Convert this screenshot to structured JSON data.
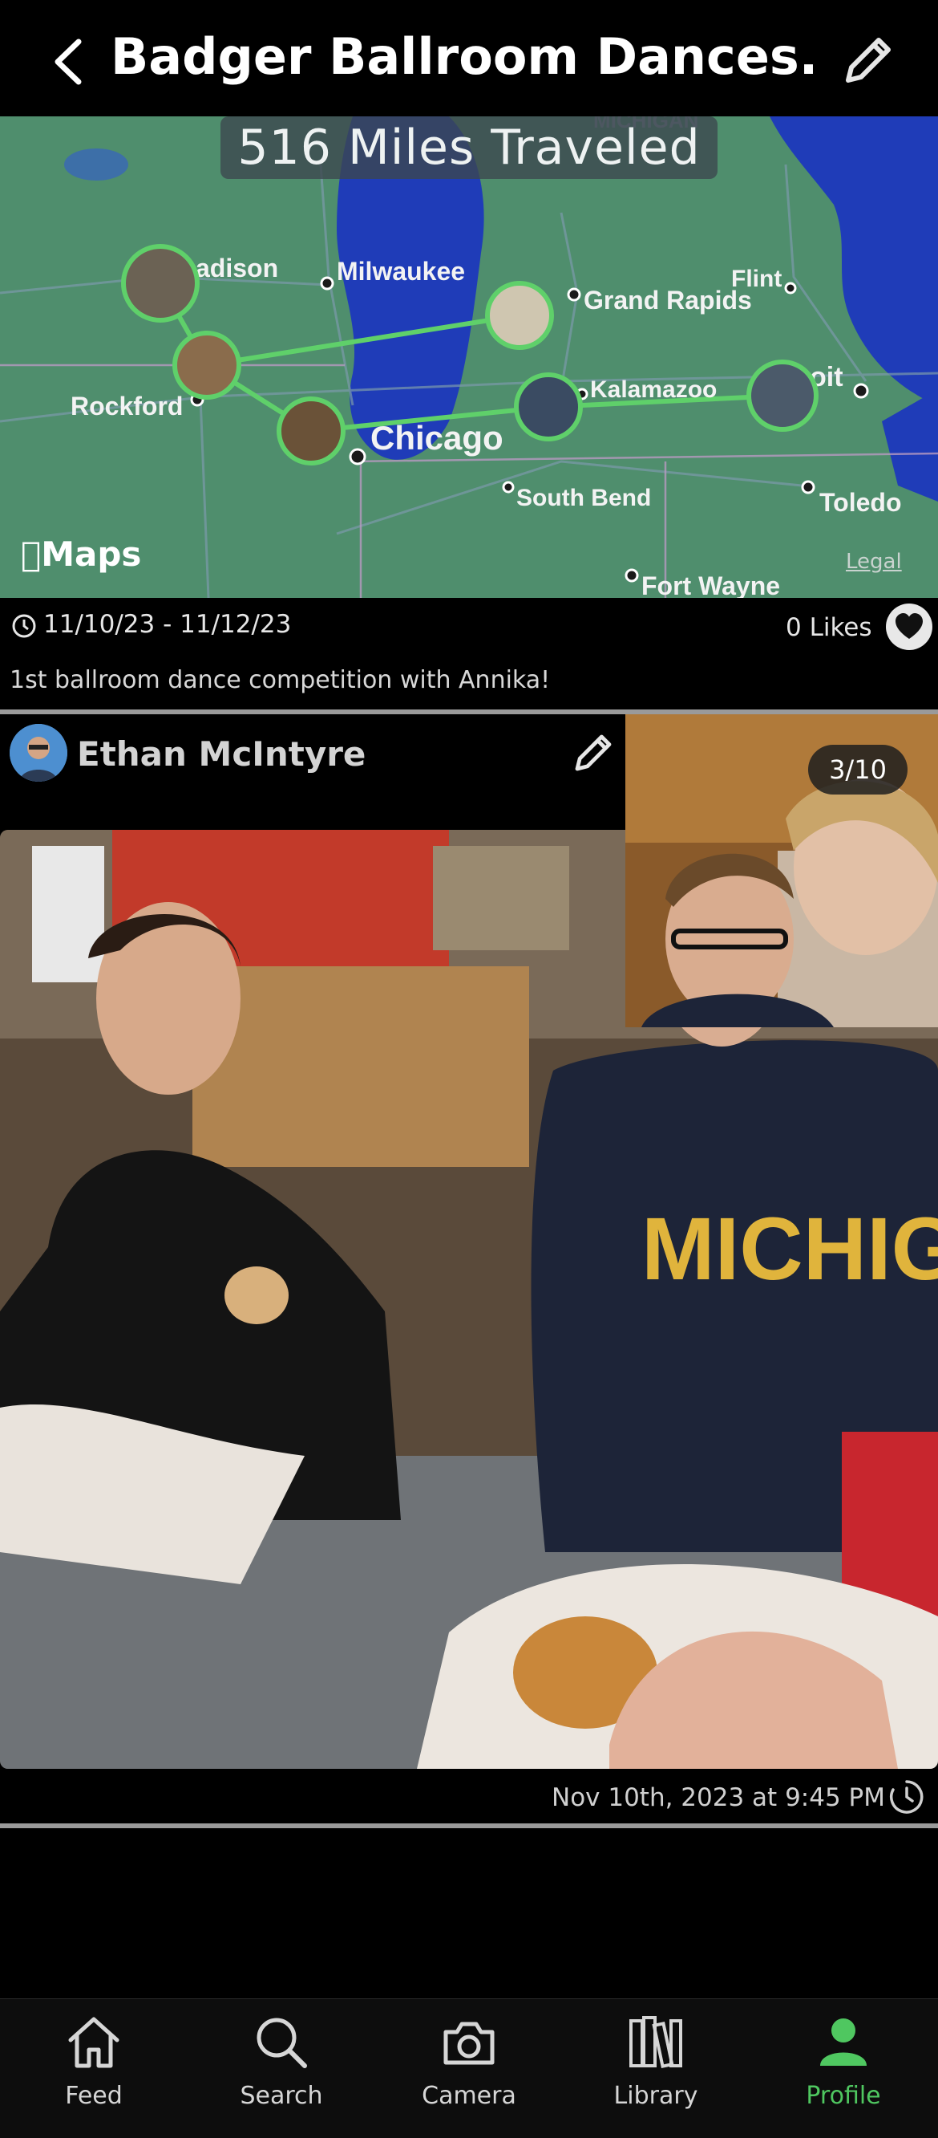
{
  "header": {
    "title": "Badger Ballroom Dances...",
    "back_icon": "chevron-left-icon",
    "edit_icon": "pencil-icon"
  },
  "map": {
    "miles_traveled": "516 Miles Traveled",
    "provider": "Maps",
    "legal": "Legal",
    "region_label": "MICHIGAN",
    "cities": [
      "adison",
      "Milwaukee",
      "Flint",
      "Grand Rapids",
      "Rockford",
      "Kalamazoo",
      "oit",
      "Chicago",
      "South Bend",
      "Toledo",
      "Fort Wayne"
    ],
    "route_color": "#5fd06a"
  },
  "trip": {
    "dates": "11/10/23 - 11/12/23",
    "likes": "0 Likes",
    "description": "1st ballroom dance competition with Annika!"
  },
  "post": {
    "author": "Ethan McIntyre",
    "photo_counter": "3/10",
    "timestamp": "Nov 10th, 2023 at 9:45 PM"
  },
  "tabs": [
    {
      "label": "Feed",
      "icon": "house-icon"
    },
    {
      "label": "Search",
      "icon": "magnifier-icon"
    },
    {
      "label": "Camera",
      "icon": "camera-icon"
    },
    {
      "label": "Library",
      "icon": "books-icon"
    },
    {
      "label": "Profile",
      "icon": "person-icon",
      "active": true
    }
  ],
  "colors": {
    "accent": "#4fc760",
    "background": "#000000",
    "map_land": "#4f8e6d",
    "map_water": "#1f3cb8"
  }
}
